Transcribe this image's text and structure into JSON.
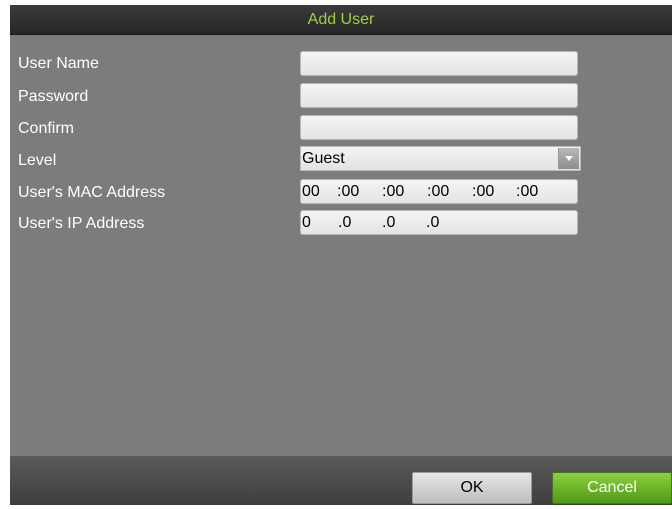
{
  "dialog": {
    "title": "Add User"
  },
  "form": {
    "user_name": {
      "label": "User Name",
      "value": ""
    },
    "password": {
      "label": "Password",
      "value": ""
    },
    "confirm": {
      "label": "Confirm",
      "value": ""
    },
    "level": {
      "label": "Level",
      "value": "Guest"
    },
    "mac": {
      "label": "User's MAC Address",
      "segments": [
        "00",
        ":00",
        ":00",
        ":00",
        ":00",
        ":00"
      ]
    },
    "ip": {
      "label": "User's IP Address",
      "segments": [
        "0",
        ".0",
        ".0",
        ".0"
      ]
    }
  },
  "buttons": {
    "ok": "OK",
    "cancel": "Cancel"
  },
  "colors": {
    "title": "#9fd13f",
    "panel": "#7c7c7c",
    "cancel_button": "#6cb52a"
  }
}
